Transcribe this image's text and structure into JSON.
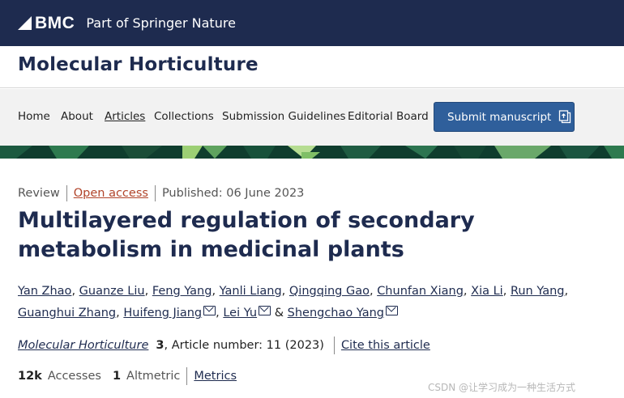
{
  "brand": {
    "logo_text": "BMC",
    "tagline": "Part of Springer Nature"
  },
  "journal": {
    "title": "Molecular Horticulture"
  },
  "nav": {
    "items": [
      "Home",
      "About",
      "Articles",
      "Collections",
      "Submission Guidelines",
      "Editorial Board"
    ],
    "active": "Articles",
    "submit_label": "Submit manuscript"
  },
  "article": {
    "type": "Review",
    "access": "Open access",
    "published": "Published: 06 June 2023",
    "title": "Multilayered regulation of secondary metabolism in medicinal plants",
    "authors": [
      {
        "name": "Yan Zhao",
        "mail": false
      },
      {
        "name": "Guanze Liu",
        "mail": false
      },
      {
        "name": "Feng Yang",
        "mail": false
      },
      {
        "name": "Yanli Liang",
        "mail": false
      },
      {
        "name": "Qingqing Gao",
        "mail": false
      },
      {
        "name": "Chunfan Xiang",
        "mail": false
      },
      {
        "name": "Xia Li",
        "mail": false
      },
      {
        "name": "Run Yang",
        "mail": false
      },
      {
        "name": "Guanghui Zhang",
        "mail": false
      },
      {
        "name": "Huifeng Jiang",
        "mail": true
      },
      {
        "name": "Lei Yu",
        "mail": true
      },
      {
        "name": "Shengchao Yang",
        "mail": true
      }
    ],
    "citation": {
      "journal": "Molecular Horticulture",
      "volume": "3",
      "details": ", Article number: 11 (2023)",
      "cite_label": "Cite this article"
    },
    "metrics": {
      "accesses_value": "12k",
      "accesses_label": "Accesses",
      "altmetric_value": "1",
      "altmetric_label": "Altmetric",
      "metrics_link": "Metrics"
    }
  },
  "watermark": "CSDN @让学习成为一种生活方式",
  "colors": {
    "header_navy": "#1e2b4f",
    "submit_blue": "#2f5f9b",
    "open_access": "#b1442a",
    "banner_green": "#0f3d2e"
  }
}
